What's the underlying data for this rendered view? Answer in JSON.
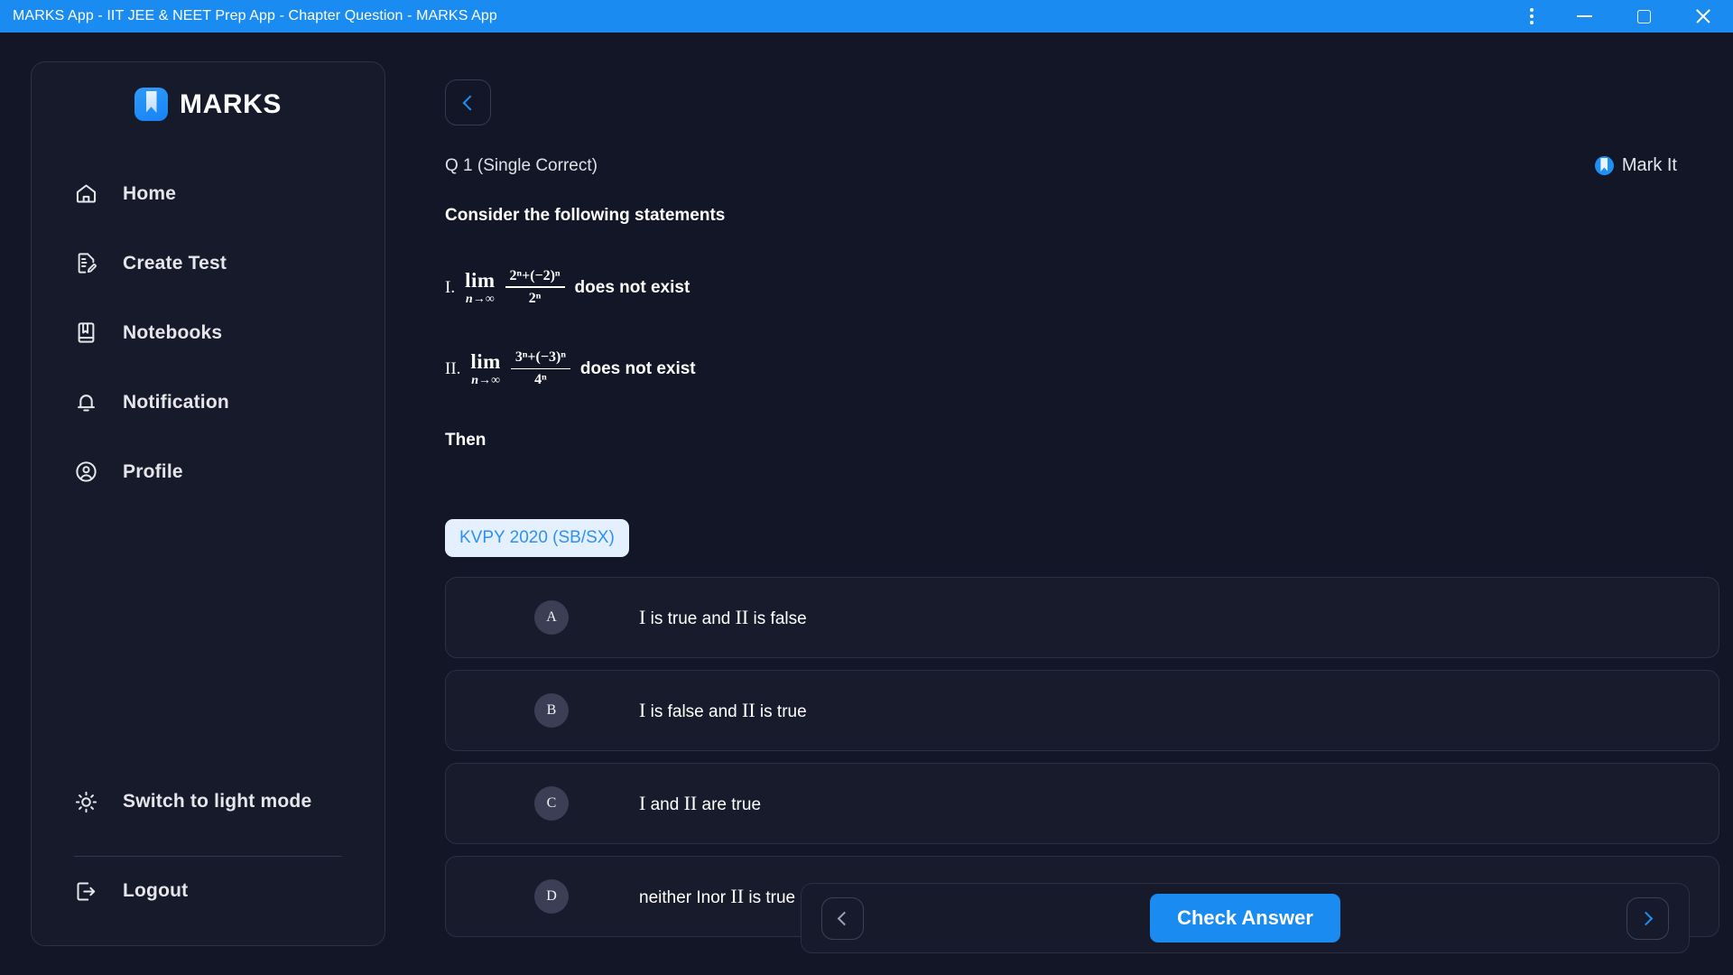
{
  "window": {
    "title": "MARKS App - IIT JEE & NEET Prep App - Chapter Question - MARKS App",
    "controls": {
      "menu": "kebab-menu-icon",
      "minimize": "minimize-icon",
      "maximize": "maximize-icon",
      "close": "close-icon"
    },
    "titlebar_color": "#1a8bf0"
  },
  "sidebar": {
    "brand": "MARKS",
    "brand_icon": "bookmark-logo-icon",
    "items": [
      {
        "label": "Home",
        "icon": "home-icon"
      },
      {
        "label": "Create Test",
        "icon": "document-edit-icon"
      },
      {
        "label": "Notebooks",
        "icon": "notebook-icon"
      },
      {
        "label": "Notification",
        "icon": "bell-icon"
      },
      {
        "label": "Profile",
        "icon": "user-circle-icon"
      }
    ],
    "bottom": [
      {
        "label": "Switch to light mode",
        "icon": "sun-icon"
      },
      {
        "label": "Logout",
        "icon": "logout-icon"
      }
    ]
  },
  "main": {
    "back_button_icon": "chevron-left-icon",
    "question_label": "Q 1 (Single Correct)",
    "mark_it": {
      "label": "Mark It",
      "icon": "bookmark-circle-icon"
    },
    "statements_intro": "Consider the following statements",
    "statements": [
      {
        "index": "I.",
        "limit": "lim",
        "limit_sub": "n→∞",
        "numerator": "2ⁿ+(−2)ⁿ",
        "denominator": "2ⁿ",
        "trailing": "does not exist"
      },
      {
        "index": "II.",
        "limit": "lim",
        "limit_sub": "n→∞",
        "numerator": "3ⁿ+(−3)ⁿ",
        "denominator": "4ⁿ",
        "trailing": "does not exist"
      }
    ],
    "then_text": "Then",
    "source_tag": "KVPY 2020 (SB/SX)",
    "options": [
      {
        "badge": "A",
        "text_pre": "I",
        "text_mid": " is true and ",
        "text_rn2": "II",
        "text_post": " is false"
      },
      {
        "badge": "B",
        "text_pre": "I",
        "text_mid": " is false and ",
        "text_rn2": "II",
        "text_post": " is true"
      },
      {
        "badge": "C",
        "text_pre": "I",
        "text_mid": " and ",
        "text_rn2": "II",
        "text_post": " are true"
      },
      {
        "badge": "D",
        "text_pre": "neither I",
        "text_mid": "nor ",
        "text_rn2": "II",
        "text_post": " is true"
      }
    ]
  },
  "bottombar": {
    "prev_icon": "chevron-left-icon",
    "check_label": "Check Answer",
    "next_icon": "chevron-right-icon",
    "accent_color": "#1a8bf0"
  }
}
